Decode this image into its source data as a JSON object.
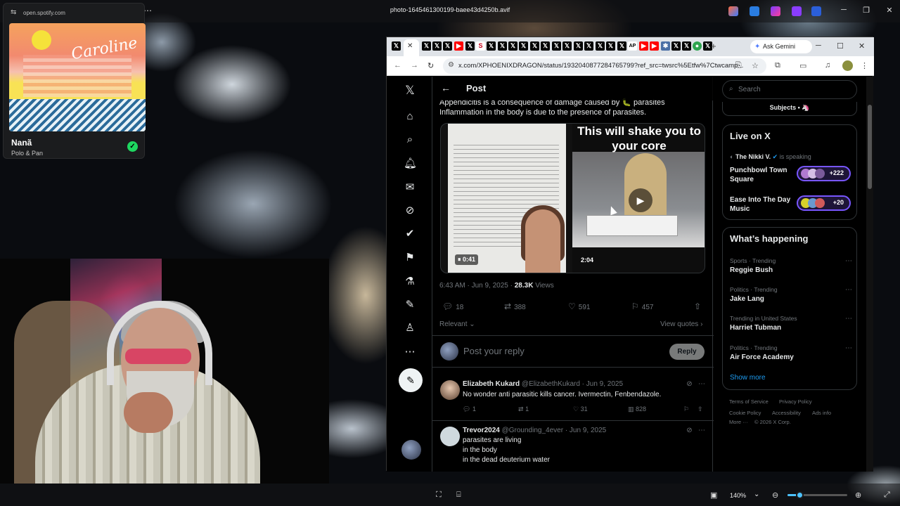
{
  "viewer": {
    "filename": "photo-1645461300199-baee43d4250b.avif",
    "zoom": "140%"
  },
  "spotify": {
    "url": "open.spotify.com",
    "track": "Nanã",
    "artist": "Polo & Pan",
    "album_art_text": "Caroline"
  },
  "browser": {
    "url": "x.com/XPHOENIXDRAGON/status/1932040877284765799?ref_src=twsrc%5Etfw%7Ctwcamp...",
    "ask_gemini": "Ask Gemini",
    "tab_letter": "S"
  },
  "post": {
    "header_title": "Post",
    "text_line1": "Appendicitis is a consequence of damage caused by 🐛 parasites",
    "text_line2": "Inflammation in the body is due to the presence of parasites.",
    "video1_time": "⏸ 0:41",
    "video2_caption": "This will shake you to your core",
    "video2_time": "2:04",
    "timestamp": "6:43 AM · Jun 9, 2025 · ",
    "views_count": "28.3K",
    "views_label": " Views",
    "replies": "18",
    "reposts": "388",
    "likes": "591",
    "bookmarks": "457",
    "sort_label": "Relevant",
    "view_quotes": "View quotes",
    "reply_placeholder": "Post your reply",
    "reply_button": "Reply"
  },
  "replies": [
    {
      "name": "Elizabeth Kukard",
      "handle": "@ElizabethKukard · Jun 9, 2025",
      "lines": [
        "No wonder anti parasitic kills cancer. Ivermectin, Fenbendazole."
      ],
      "replies": "1",
      "reposts": "1",
      "likes": "31",
      "views": "828"
    },
    {
      "name": "Trevor2024",
      "handle": "@Grounding_4ever · Jun 9, 2025",
      "lines": [
        "parasites are living",
        "in the body",
        "in the dead deuterium water"
      ]
    }
  ],
  "sidebar": {
    "search_placeholder": "Search",
    "subjects": "Subjects • 🦄",
    "live_title": "Live on X",
    "live_host_name": "The Nikki V.",
    "live_host_status": " is speaking",
    "spaces": [
      {
        "title": "Punchbowl Town Square",
        "count": "+222"
      },
      {
        "title": "Ease Into The Day Music",
        "count": "+20"
      }
    ],
    "happening_title": "What’s happening",
    "trends": [
      {
        "context": "Sports · Trending",
        "name": "Reggie Bush"
      },
      {
        "context": "Politics · Trending",
        "name": "Jake Lang"
      },
      {
        "context": "Trending in United States",
        "name": "Harriet Tubman"
      },
      {
        "context": "Politics · Trending",
        "name": "Air Force Academy"
      }
    ],
    "show_more": "Show more",
    "footer": [
      "Terms of Service",
      "Privacy Policy",
      "Cookie Policy",
      "Accessibility",
      "Ads info",
      "More ···",
      "© 2026 X Corp."
    ]
  },
  "icons": {
    "x_logo": "x-logo-icon",
    "home": "home-icon",
    "search": "search-icon",
    "notifications": "bell-icon",
    "messages": "mail-icon",
    "grok": "grok-icon",
    "verified": "verified-icon",
    "bookmarks": "bookmark-icon",
    "jobs": "flask-icon",
    "lists": "list-icon",
    "profile": "profile-icon",
    "more": "more-icon"
  },
  "colors": {
    "accent": "#1d9bf0",
    "spaces": "#7856ff",
    "spotify_green": "#1ed760"
  }
}
